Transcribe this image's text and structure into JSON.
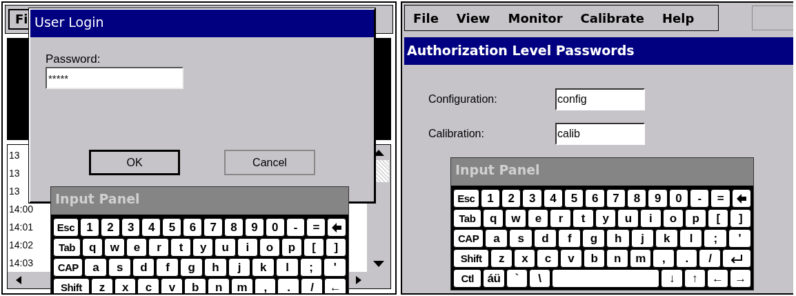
{
  "left_screen": {
    "menu_bar": {
      "items": [
        "Fi"
      ]
    },
    "log_list": {
      "rows": [
        "13",
        "13",
        "13",
        "14:00",
        "14:01",
        "14:02",
        "14:03"
      ]
    },
    "login_dialog": {
      "title": "User Login",
      "password_label": "Password:",
      "password_value": "*****",
      "buttons": [
        {
          "label": "OK",
          "default": true
        },
        {
          "label": "Cancel",
          "default": false
        }
      ]
    },
    "input_panel": {
      "title": "Input Panel",
      "rows": [
        {
          "keys": [
            {
              "kind": "key",
              "label": "Esc"
            },
            {
              "kind": "key",
              "label": "1"
            },
            {
              "kind": "key",
              "label": "2"
            },
            {
              "kind": "key",
              "label": "3"
            },
            {
              "kind": "key",
              "label": "4"
            },
            {
              "kind": "key",
              "label": "5"
            },
            {
              "kind": "key",
              "label": "6"
            },
            {
              "kind": "key",
              "label": "7"
            },
            {
              "kind": "key",
              "label": "8"
            },
            {
              "kind": "key",
              "label": "9"
            },
            {
              "kind": "key",
              "label": "0"
            },
            {
              "kind": "key",
              "label": "-"
            },
            {
              "kind": "key",
              "label": "="
            },
            {
              "kind": "backspace"
            }
          ]
        },
        {
          "keys": [
            {
              "kind": "key",
              "label": "Tab"
            },
            {
              "kind": "key",
              "label": "q"
            },
            {
              "kind": "key",
              "label": "w"
            },
            {
              "kind": "key",
              "label": "e"
            },
            {
              "kind": "key",
              "label": "r"
            },
            {
              "kind": "key",
              "label": "t"
            },
            {
              "kind": "key",
              "label": "y"
            },
            {
              "kind": "key",
              "label": "u"
            },
            {
              "kind": "key",
              "label": "i"
            },
            {
              "kind": "key",
              "label": "o"
            },
            {
              "kind": "key",
              "label": "p"
            },
            {
              "kind": "key",
              "label": "["
            },
            {
              "kind": "key",
              "label": "]"
            }
          ]
        },
        {
          "keys": [
            {
              "kind": "key",
              "label": "CAP"
            },
            {
              "kind": "key",
              "label": "a"
            },
            {
              "kind": "key",
              "label": "s"
            },
            {
              "kind": "key",
              "label": "d"
            },
            {
              "kind": "key",
              "label": "f"
            },
            {
              "kind": "key",
              "label": "g"
            },
            {
              "kind": "key",
              "label": "h"
            },
            {
              "kind": "key",
              "label": "j"
            },
            {
              "kind": "key",
              "label": "k"
            },
            {
              "kind": "key",
              "label": "l"
            },
            {
              "kind": "key",
              "label": ";"
            },
            {
              "kind": "key",
              "label": "'"
            }
          ]
        },
        {
          "keys": [
            {
              "kind": "key",
              "label": "Shift"
            },
            {
              "kind": "key",
              "label": "z"
            },
            {
              "kind": "key",
              "label": "x"
            },
            {
              "kind": "key",
              "label": "c"
            },
            {
              "kind": "key",
              "label": "v"
            },
            {
              "kind": "key",
              "label": "b"
            },
            {
              "kind": "key",
              "label": "n"
            },
            {
              "kind": "key",
              "label": "m"
            },
            {
              "kind": "key",
              "label": ","
            },
            {
              "kind": "key",
              "label": "."
            },
            {
              "kind": "key",
              "label": "/"
            },
            {
              "kind": "key",
              "label": "←"
            }
          ]
        }
      ]
    }
  },
  "right_screen": {
    "menu_bar": {
      "items": [
        "File",
        "View",
        "Monitor",
        "Calibrate",
        "Help"
      ]
    },
    "title": "Authorization Level Passwords",
    "fields": [
      {
        "label": "Configuration:",
        "value": "config"
      },
      {
        "label": "Calibration:",
        "value": "calib"
      }
    ],
    "input_panel": {
      "title": "Input Panel",
      "rows": [
        {
          "keys": [
            {
              "kind": "key",
              "label": "Esc"
            },
            {
              "kind": "key",
              "label": "1"
            },
            {
              "kind": "key",
              "label": "2"
            },
            {
              "kind": "key",
              "label": "3"
            },
            {
              "kind": "key",
              "label": "4"
            },
            {
              "kind": "key",
              "label": "5"
            },
            {
              "kind": "key",
              "label": "6"
            },
            {
              "kind": "key",
              "label": "7"
            },
            {
              "kind": "key",
              "label": "8"
            },
            {
              "kind": "key",
              "label": "9"
            },
            {
              "kind": "key",
              "label": "0"
            },
            {
              "kind": "key",
              "label": "-"
            },
            {
              "kind": "key",
              "label": "="
            },
            {
              "kind": "backspace"
            }
          ]
        },
        {
          "keys": [
            {
              "kind": "key",
              "label": "Tab"
            },
            {
              "kind": "key",
              "label": "q"
            },
            {
              "kind": "key",
              "label": "w"
            },
            {
              "kind": "key",
              "label": "e"
            },
            {
              "kind": "key",
              "label": "r"
            },
            {
              "kind": "key",
              "label": "t"
            },
            {
              "kind": "key",
              "label": "y"
            },
            {
              "kind": "key",
              "label": "u"
            },
            {
              "kind": "key",
              "label": "i"
            },
            {
              "kind": "key",
              "label": "o"
            },
            {
              "kind": "key",
              "label": "p"
            },
            {
              "kind": "key",
              "label": "["
            },
            {
              "kind": "key",
              "label": "]"
            }
          ]
        },
        {
          "keys": [
            {
              "kind": "key",
              "label": "CAP"
            },
            {
              "kind": "key",
              "label": "a"
            },
            {
              "kind": "key",
              "label": "s"
            },
            {
              "kind": "key",
              "label": "d"
            },
            {
              "kind": "key",
              "label": "f"
            },
            {
              "kind": "key",
              "label": "g"
            },
            {
              "kind": "key",
              "label": "h"
            },
            {
              "kind": "key",
              "label": "j"
            },
            {
              "kind": "key",
              "label": "k"
            },
            {
              "kind": "key",
              "label": "l"
            },
            {
              "kind": "key",
              "label": ";"
            },
            {
              "kind": "key",
              "label": "'"
            }
          ]
        },
        {
          "keys": [
            {
              "kind": "key",
              "label": "Shift"
            },
            {
              "kind": "key",
              "label": "z"
            },
            {
              "kind": "key",
              "label": "x"
            },
            {
              "kind": "key",
              "label": "c"
            },
            {
              "kind": "key",
              "label": "v"
            },
            {
              "kind": "key",
              "label": "b"
            },
            {
              "kind": "key",
              "label": "n"
            },
            {
              "kind": "key",
              "label": "m"
            },
            {
              "kind": "key",
              "label": ","
            },
            {
              "kind": "key",
              "label": "."
            },
            {
              "kind": "key",
              "label": "/"
            },
            {
              "kind": "enter"
            }
          ]
        },
        {
          "keys": [
            {
              "kind": "key",
              "label": "Ctl"
            },
            {
              "kind": "key",
              "label": "áü"
            },
            {
              "kind": "key",
              "label": "`"
            },
            {
              "kind": "key",
              "label": "\\"
            },
            {
              "kind": "space"
            },
            {
              "kind": "key",
              "label": "↓"
            },
            {
              "kind": "key",
              "label": "↑"
            },
            {
              "kind": "key",
              "label": "←"
            },
            {
              "kind": "key",
              "label": "→"
            }
          ]
        }
      ]
    }
  }
}
